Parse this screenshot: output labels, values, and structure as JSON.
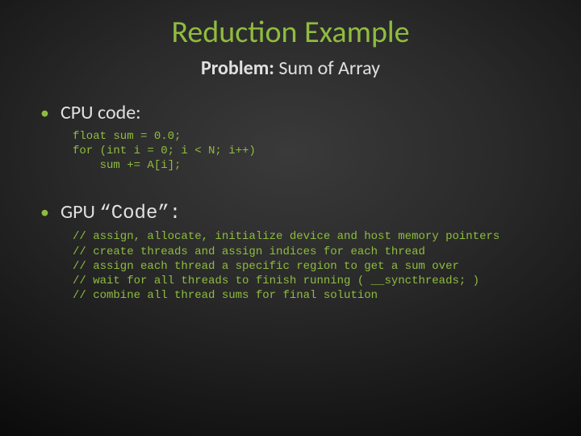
{
  "title": "Reduction Example",
  "subtitle_label": "Problem:",
  "subtitle_value": " Sum of Array",
  "bullet_cpu": "CPU code:",
  "code_cpu": "float sum = 0.0;\nfor (int i = 0; i < N; i++)\n    sum += A[i];",
  "bullet_gpu_prefix": "GPU ",
  "bullet_gpu_code": "“Code”:",
  "code_gpu": "// assign, allocate, initialize device and host memory pointers\n// create threads and assign indices for each thread\n// assign each thread a specific region to get a sum over\n// wait for all threads to finish running ( __syncthreads; )\n// combine all thread sums for final solution"
}
